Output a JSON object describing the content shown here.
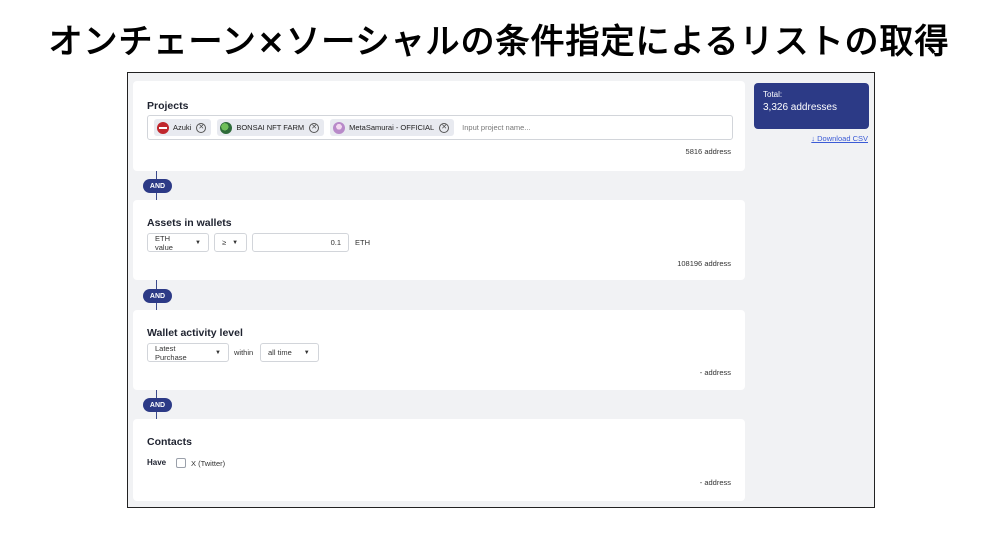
{
  "heading": "オンチェーン×ソーシャルの条件指定によるリストの取得",
  "projects": {
    "title": "Projects",
    "chips": [
      {
        "label": "Azuki",
        "icon": "azuki-logo-icon",
        "color": "#c0272d"
      },
      {
        "label": "BONSAI NFT FARM",
        "icon": "bonsai-logo-icon",
        "color": "#2e6b3a"
      },
      {
        "label": "MetaSamurai - OFFICIAL",
        "icon": "metasamurai-logo-icon",
        "color": "#b88ac9"
      }
    ],
    "placeholder": "Input project name...",
    "count": "5816 address"
  },
  "and_label": "AND",
  "assets": {
    "title": "Assets in wallets",
    "type_select": "ETH value",
    "operator_select": "≥",
    "amount": "0.1",
    "unit": "ETH",
    "count": "108196 address"
  },
  "activity": {
    "title": "Wallet activity level",
    "type_select": "Latest Purchase",
    "within_label": "within",
    "period_select": "all time",
    "count": "- address"
  },
  "contacts": {
    "title": "Contacts",
    "have_label": "Have",
    "option_label": "X (Twitter)",
    "count": "- address"
  },
  "summary": {
    "total_label": "Total:",
    "total_value": "3,326 addresses",
    "download_label": "↓ Download CSV"
  },
  "colors": {
    "accent": "#2c3a86",
    "link": "#3b5bd6",
    "background": "#f1f2f4"
  }
}
